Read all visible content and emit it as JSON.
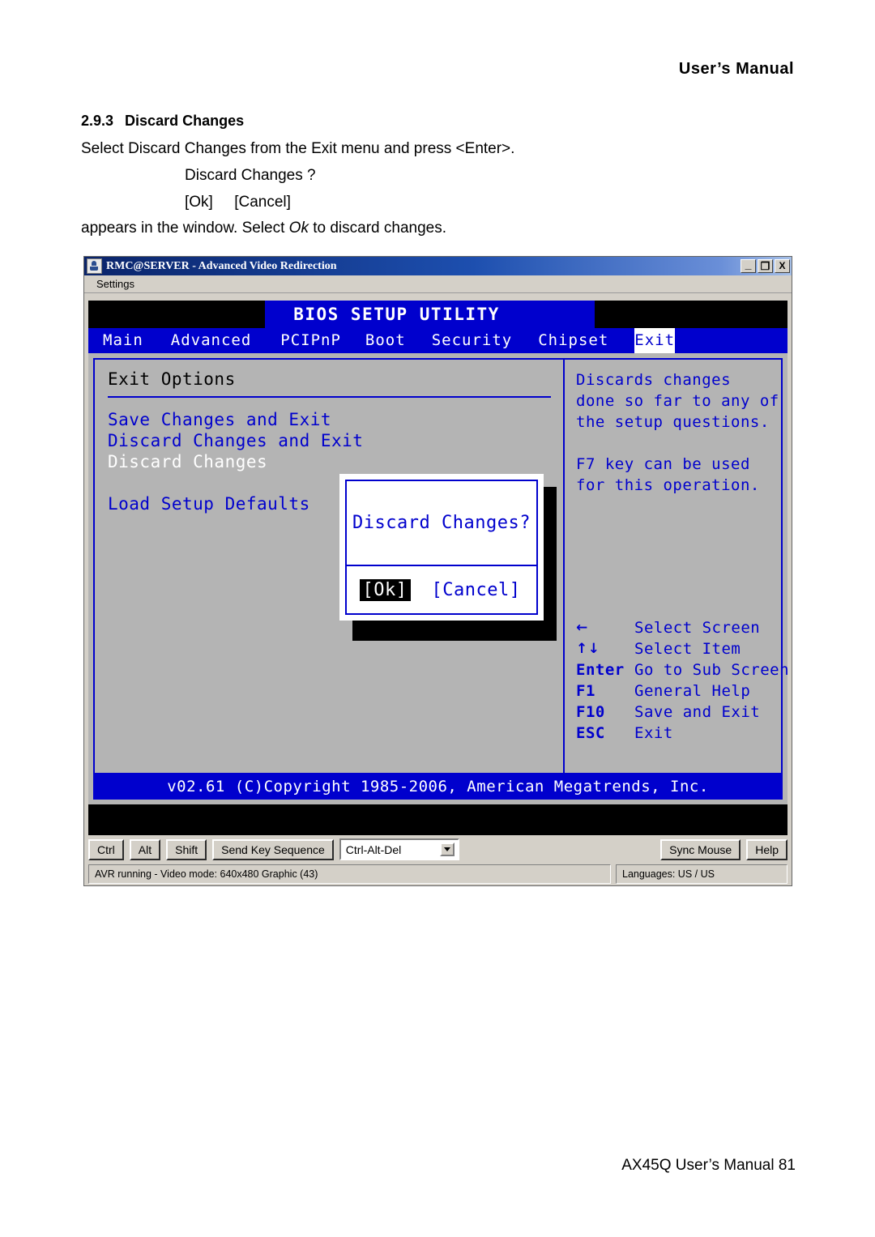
{
  "document": {
    "header": "User’s Manual",
    "section_number": "2.9.3",
    "section_title": "Discard Changes",
    "line1": "Select Discard Changes from the Exit menu and press <Enter>.",
    "line2": "Discard Changes ?",
    "line3": "[Ok]     [Cancel]",
    "line4_before": "appears in the window. Select ",
    "line4_italic": "Ok",
    "line4_after": " to discard changes.",
    "footer": "AX45Q User’s Manual 81"
  },
  "app_window": {
    "title": "RMC@SERVER - Advanced Video Redirection",
    "icon": "java-coffee-cup-icon",
    "window_buttons": {
      "minimize": "_",
      "maximize": "❐",
      "close": "X"
    },
    "menu": [
      "Settings"
    ]
  },
  "bios": {
    "title": "BIOS SETUP UTILITY",
    "tabs": [
      {
        "label": "Main",
        "active": false
      },
      {
        "label": "Advanced",
        "active": false
      },
      {
        "label": "PCIPnP",
        "active": false
      },
      {
        "label": "Boot",
        "active": false
      },
      {
        "label": "Security",
        "active": false
      },
      {
        "label": "Chipset",
        "active": false
      },
      {
        "label": "Exit",
        "active": true
      }
    ],
    "left_pane": {
      "title": "Exit Options",
      "items": [
        {
          "label": "Save Changes and Exit",
          "selected": false
        },
        {
          "label": "Discard Changes and Exit",
          "selected": false
        },
        {
          "label": "Discard Changes",
          "selected": true
        },
        {
          "label": "Load Setup Defaults",
          "selected": false
        }
      ]
    },
    "right_pane": {
      "help": [
        "Discards changes",
        "done so far to any of",
        "the setup questions.",
        "F7 key can be used",
        "for this operation."
      ],
      "keys": [
        {
          "key": "←",
          "desc": "Select Screen",
          "symbol": true
        },
        {
          "key": "↑↓",
          "desc": "Select Item",
          "symbol": true
        },
        {
          "key": "Enter",
          "desc": "Go to Sub Screen",
          "symbol": false
        },
        {
          "key": "F1",
          "desc": "General Help",
          "symbol": false
        },
        {
          "key": "F10",
          "desc": "Save and Exit",
          "symbol": false
        },
        {
          "key": "ESC",
          "desc": "Exit",
          "symbol": false
        }
      ]
    },
    "dialog": {
      "message": "Discard Changes?",
      "ok_label": "[Ok]",
      "cancel_label": "[Cancel]",
      "selected": "ok"
    },
    "footer": "v02.61 (C)Copyright 1985-2006, American Megatrends, Inc."
  },
  "toolbar": {
    "ctrl": "Ctrl",
    "alt": "Alt",
    "shift": "Shift",
    "send_key_sequence": "Send Key Sequence",
    "key_sequence_value": "Ctrl-Alt-Del",
    "sync_mouse": "Sync Mouse",
    "help": "Help"
  },
  "statusbar": {
    "avr_status": "AVR running - Video mode: 640x480 Graphic (43)",
    "languages": "Languages: US / US"
  },
  "colors": {
    "bios_blue": "#0000cd",
    "bios_gray": "#b4b4b4",
    "window_face": "#d4d0c8",
    "titlebar_blue": "#0a246a"
  }
}
